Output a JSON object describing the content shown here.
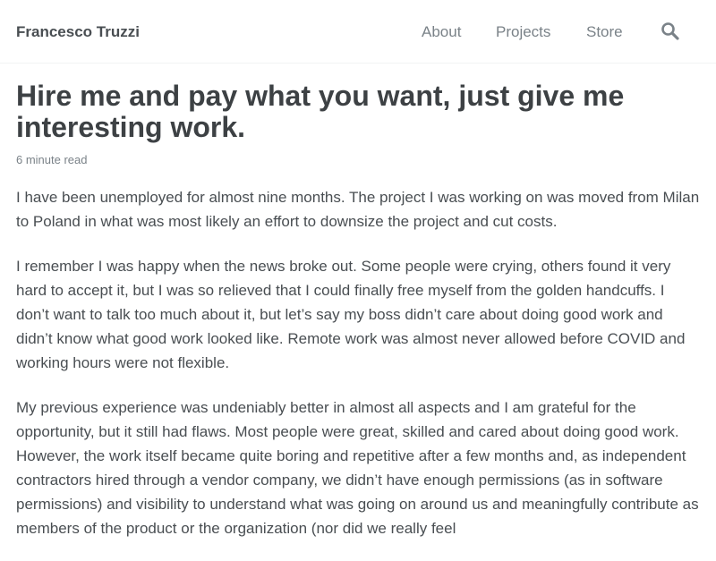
{
  "header": {
    "site_title": "Francesco Truzzi",
    "nav": [
      {
        "label": "About"
      },
      {
        "label": "Projects"
      },
      {
        "label": "Store"
      }
    ],
    "search_icon": "search-icon"
  },
  "article": {
    "title": "Hire me and pay what you want, just give me interesting work.",
    "read_time": "6 minute read",
    "paragraphs": [
      "I have been unemployed for almost nine months. The project I was working on was moved from Milan to Poland in what was most likely an effort to downsize the project and cut costs.",
      "I remember I was happy when the news broke out. Some people were crying, others found it very hard to accept it, but I was so relieved that I could finally free myself from the golden handcuffs. I don’t want to talk too much about it, but let’s say my boss didn’t care about doing good work and didn’t know what good work looked like. Remote work was almost never allowed before COVID and working hours were not flexible.",
      "My previous experience was undeniably better in almost all aspects and I am grateful for the opportunity, but it still had flaws. Most people were great, skilled and cared about doing good work. However, the work itself became quite boring and repetitive after a few months and, as independent contractors hired through a vendor company, we didn’t have enough permissions (as in software permissions) and visibility to understand what was going on around us and meaningfully contribute as members of the product or the organization (nor did we really feel"
    ]
  }
}
